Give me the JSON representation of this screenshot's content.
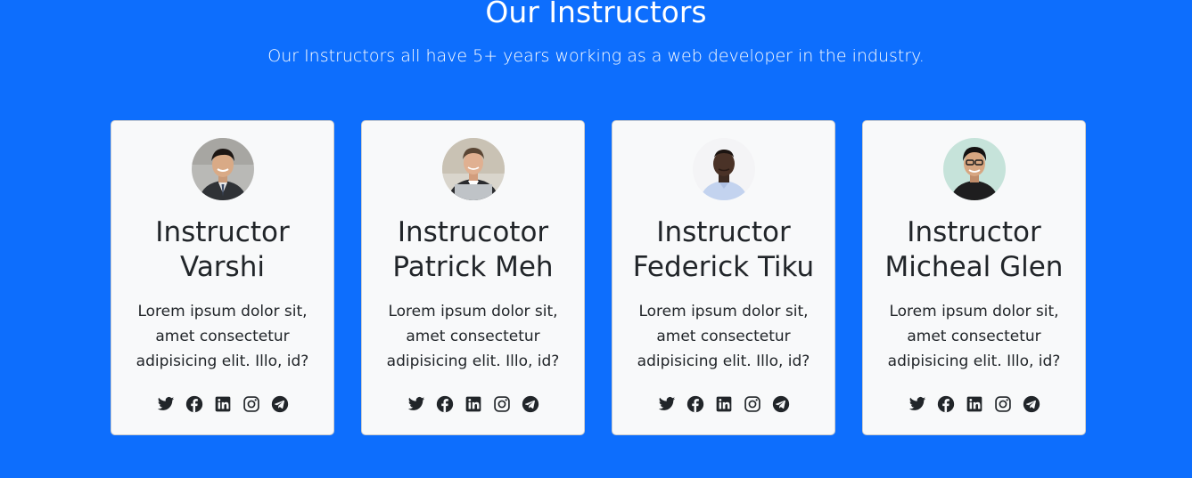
{
  "section": {
    "title": "Our Instructors",
    "subtitle": "Our Instructors all have 5+ years working as a web developer in the industry."
  },
  "colors": {
    "background": "#0d6efd",
    "card": "#f8f9fa",
    "text": "#212529"
  },
  "instructors": [
    {
      "name": "Instructor Varshi",
      "description": "Lorem ipsum dolor sit, amet consectetur adipisicing elit. Illo, id?",
      "avatar": "instructor-varshi-avatar",
      "socials": [
        "twitter-icon",
        "facebook-icon",
        "linkedin-icon",
        "instagram-icon",
        "telegram-icon"
      ]
    },
    {
      "name": "Instrucotor Patrick Meh",
      "description": "Lorem ipsum dolor sit, amet consectetur adipisicing elit. Illo, id?",
      "avatar": "instructor-patrick-avatar",
      "socials": [
        "twitter-icon",
        "facebook-icon",
        "linkedin-icon",
        "instagram-icon",
        "telegram-icon"
      ]
    },
    {
      "name": "Instructor Federick Tiku",
      "description": "Lorem ipsum dolor sit, amet consectetur adipisicing elit. Illo, id?",
      "avatar": "instructor-federick-avatar",
      "socials": [
        "twitter-icon",
        "facebook-icon",
        "linkedin-icon",
        "instagram-icon",
        "telegram-icon"
      ]
    },
    {
      "name": "Instructor Micheal Glen",
      "description": "Lorem ipsum dolor sit, amet consectetur adipisicing elit. Illo, id?",
      "avatar": "instructor-micheal-avatar",
      "socials": [
        "twitter-icon",
        "facebook-icon",
        "linkedin-icon",
        "instagram-icon",
        "telegram-icon"
      ]
    }
  ]
}
